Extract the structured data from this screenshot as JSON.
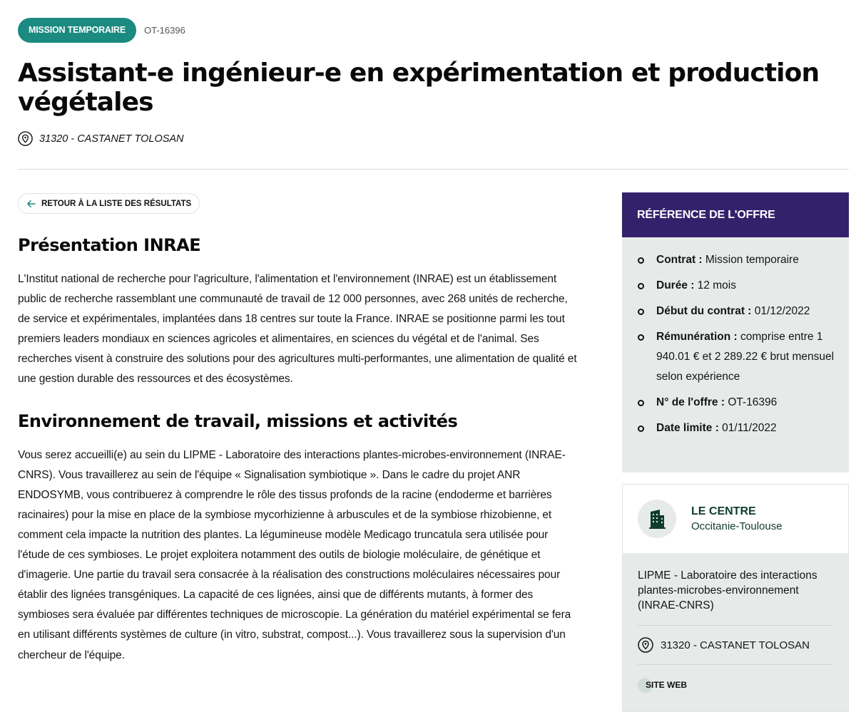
{
  "header": {
    "badge": "MISSION TEMPORAIRE",
    "reference": "OT-16396",
    "title": "Assistant-e ingénieur-e en expérimentation et production végétales",
    "location": "31320 - CASTANET TOLOSAN",
    "icons": {
      "location": "location-pin-icon"
    }
  },
  "main": {
    "back_label": "RETOUR À LA LISTE DES RÉSULTATS",
    "sections": [
      {
        "heading": "Présentation INRAE",
        "text": "L'Institut national de recherche pour l'agriculture, l'alimentation et l'environnement (INRAE) est un établissement public de recherche rassemblant une communauté de travail de 12 000 personnes, avec 268 unités de recherche, de service et expérimentales, implantées dans 18 centres sur toute la France. INRAE se positionne parmi les tout premiers leaders mondiaux en sciences agricoles et alimentaires, en sciences du végétal et de l'animal. Ses recherches visent à construire des solutions pour des agricultures multi-performantes, une alimentation de qualité et une gestion durable des ressources et des écosystèmes."
      },
      {
        "heading": "Environnement de travail, missions et activités",
        "text": "Vous serez accueilli(e) au sein du LIPME - Laboratoire des interactions plantes-microbes-environnement (INRAE-CNRS). Vous travaillerez au sein de l'équipe « Signalisation symbiotique ». Dans le cadre du projet ANR ENDOSYMB, vous contribuerez à comprendre le rôle des tissus profonds de la racine (endoderme et barrières racinaires) pour la mise en place de la symbiose mycorhizienne à arbuscules et de la symbiose rhizobienne, et comment cela impacte la nutrition des plantes. La légumineuse modèle Medicago truncatula sera utilisée pour l'étude de ces symbioses. Le projet exploitera notamment des outils de biologie moléculaire, de génétique et d'imagerie. Une partie du travail sera consacrée à la réalisation des constructions moléculaires nécessaires pour établir des lignées transgéniques. La capacité de ces lignées, ainsi que de différents mutants, à former des symbioses sera évaluée par différentes techniques de microscopie. La génération du matériel expérimental se fera en utilisant différents systèmes de culture (in vitro, substrat, compost...). Vous travaillerez sous la supervision d'un chercheur de l'équipe."
      }
    ]
  },
  "offer_ref": {
    "heading": "RÉFÉRENCE DE L'OFFRE",
    "items": [
      {
        "label": "Contrat :",
        "value": "Mission temporaire"
      },
      {
        "label": "Durée :",
        "value": "12 mois"
      },
      {
        "label": "Début du contrat :",
        "value": "01/12/2022"
      },
      {
        "label": "Rémunération :",
        "value": "comprise entre 1 940.01 € et 2 289.22 € brut mensuel selon expérience"
      },
      {
        "label": "N° de l'offre :",
        "value": "OT-16396"
      },
      {
        "label": "Date limite :",
        "value": "01/11/2022"
      }
    ]
  },
  "center": {
    "title": "LE CENTRE",
    "subtitle": "Occitanie-Toulouse",
    "description": "LIPME - Laboratoire des interactions plantes-microbes-environnement (INRAE-CNRS)",
    "location": "31320 - CASTANET TOLOSAN",
    "site_label": "SITE WEB",
    "icons": {
      "building": "building-icon",
      "location": "location-pin-icon"
    }
  },
  "colors": {
    "badge_bg": "#1b8a80",
    "ref_header_bg": "#34216b",
    "panel_bg": "#e6ebea",
    "center_text": "#0f3b2f"
  }
}
